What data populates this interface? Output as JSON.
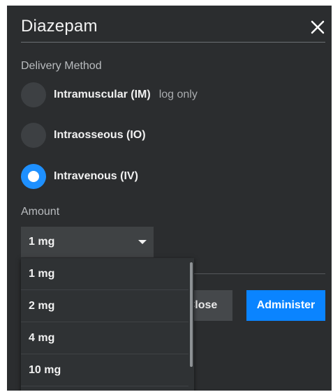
{
  "dialog": {
    "title": "Diazepam",
    "close_icon": "close-icon"
  },
  "delivery": {
    "label": "Delivery Method",
    "options": [
      {
        "label": "Intramuscular (IM)",
        "note": "log only",
        "selected": false
      },
      {
        "label": "Intraosseous (IO)",
        "note": "",
        "selected": false
      },
      {
        "label": "Intravenous (IV)",
        "note": "",
        "selected": true
      }
    ]
  },
  "amount": {
    "label": "Amount",
    "selected": "1 mg",
    "options": [
      "1 mg",
      "2 mg",
      "4 mg",
      "10 mg"
    ]
  },
  "buttons": {
    "close_label": "Close",
    "administer_label": "Administer"
  },
  "colors": {
    "background": "#2b2d2f",
    "accent": "#0a84ff"
  }
}
